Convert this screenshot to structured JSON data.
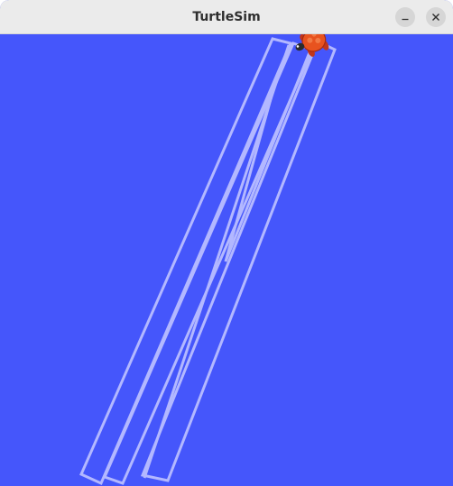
{
  "window": {
    "title": "TurtleSim"
  },
  "controls": {
    "minimize_icon": "minimize-icon",
    "close_icon": "close-icon"
  },
  "canvas": {
    "background_color": "#4556fb",
    "pen_color": "#b3b8ff",
    "turtle_icon": "turtle-icon"
  },
  "colors": {
    "titlebar": "#ebebeb",
    "title_text": "#2e2e2e",
    "button_bg": "#d6d6d6",
    "turtle_shell": "#e8531f"
  }
}
